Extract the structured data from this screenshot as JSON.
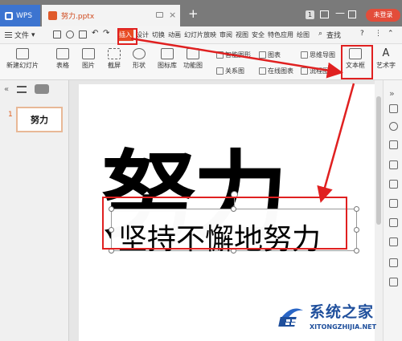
{
  "titlebar": {
    "app_tab": "WPS",
    "doc_tab": "努力.pptx",
    "badge_count": "1",
    "login_label": "未登录"
  },
  "menubar": {
    "file_label": "文件",
    "items": [
      "插入",
      "设计",
      "切换",
      "动画",
      "幻灯片放映",
      "审阅",
      "视图",
      "安全",
      "特色应用",
      "绘图"
    ],
    "search_label": "查找",
    "help_label": "?"
  },
  "ribbon": {
    "new_slide": "新建幻灯片",
    "table": "表格",
    "picture": "图片",
    "screenshot": "截屏",
    "shape": "形状",
    "icon_lib": "图标库",
    "function_chart": "功能图",
    "smart_shape": "智能图形",
    "chart": "图表",
    "relation_chart": "关系图",
    "online_chart": "在线图表",
    "mindmap": "思维导图",
    "flowchart": "流程图",
    "textbox": "文本框",
    "wordart": "艺术字"
  },
  "slide": {
    "number": "1",
    "thumb_text": "努力",
    "big_text": "努力",
    "textbox_text": "坚持不懈地努力"
  },
  "watermark": {
    "title": "系统之家",
    "subtitle": "XITONGZHIJIA.NET"
  },
  "colors": {
    "accent_red": "#e02020",
    "active_tab": "#e84c24",
    "wps_blue": "#3c74d0"
  }
}
